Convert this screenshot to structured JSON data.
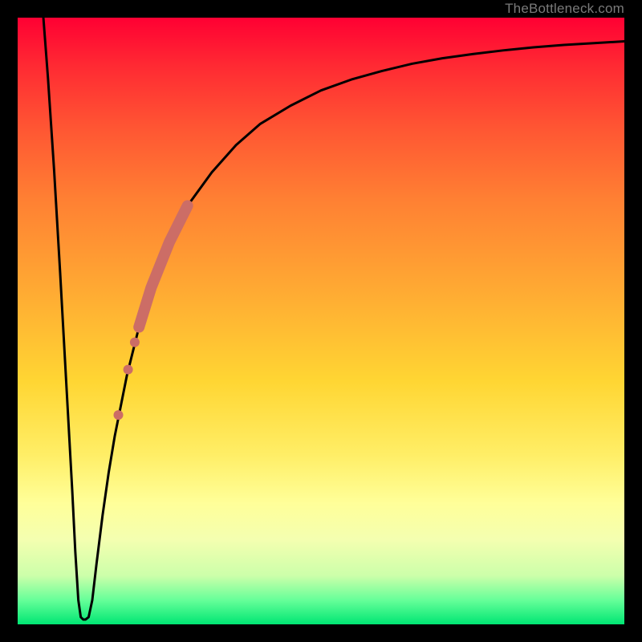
{
  "watermark": "TheBottleneck.com",
  "colors": {
    "frame": "#000000",
    "curve": "#000000",
    "highlight_stroke": "#cc6d66",
    "highlight_fill": "#cc6d66"
  },
  "chart_data": {
    "type": "line",
    "title": "",
    "xlabel": "",
    "ylabel": "",
    "xlim": [
      0,
      100
    ],
    "ylim": [
      0,
      100
    ],
    "grid": false,
    "legend": false,
    "curve_points": [
      {
        "x": 4.24,
        "y": 100.0
      },
      {
        "x": 5.0,
        "y": 90.0
      },
      {
        "x": 6.0,
        "y": 75.0
      },
      {
        "x": 7.0,
        "y": 58.0
      },
      {
        "x": 8.0,
        "y": 40.0
      },
      {
        "x": 9.0,
        "y": 22.0
      },
      {
        "x": 9.5,
        "y": 12.0
      },
      {
        "x": 10.0,
        "y": 4.0
      },
      {
        "x": 10.4,
        "y": 1.2
      },
      {
        "x": 10.8,
        "y": 0.8
      },
      {
        "x": 11.2,
        "y": 0.8
      },
      {
        "x": 11.7,
        "y": 1.2
      },
      {
        "x": 12.3,
        "y": 4.0
      },
      {
        "x": 13.0,
        "y": 10.0
      },
      {
        "x": 14.0,
        "y": 18.0
      },
      {
        "x": 15.0,
        "y": 25.0
      },
      {
        "x": 16.0,
        "y": 31.0
      },
      {
        "x": 18.0,
        "y": 41.0
      },
      {
        "x": 20.0,
        "y": 49.0
      },
      {
        "x": 22.0,
        "y": 55.5
      },
      {
        "x": 25.0,
        "y": 63.0
      },
      {
        "x": 28.0,
        "y": 69.0
      },
      {
        "x": 32.0,
        "y": 74.5
      },
      {
        "x": 36.0,
        "y": 79.0
      },
      {
        "x": 40.0,
        "y": 82.5
      },
      {
        "x": 45.0,
        "y": 85.5
      },
      {
        "x": 50.0,
        "y": 88.0
      },
      {
        "x": 55.0,
        "y": 89.8
      },
      {
        "x": 60.0,
        "y": 91.2
      },
      {
        "x": 65.0,
        "y": 92.4
      },
      {
        "x": 70.0,
        "y": 93.3
      },
      {
        "x": 75.0,
        "y": 94.0
      },
      {
        "x": 80.0,
        "y": 94.6
      },
      {
        "x": 85.0,
        "y": 95.1
      },
      {
        "x": 90.0,
        "y": 95.5
      },
      {
        "x": 95.0,
        "y": 95.8
      },
      {
        "x": 100.0,
        "y": 96.1
      }
    ],
    "highlight_segment": {
      "comment": "thick pinkish segment along the rising part of the curve",
      "points": [
        {
          "x": 20.0,
          "y": 49.0
        },
        {
          "x": 22.0,
          "y": 55.5
        },
        {
          "x": 25.0,
          "y": 63.0
        },
        {
          "x": 28.0,
          "y": 69.0
        }
      ],
      "stroke_width": 14
    },
    "highlight_dots": [
      {
        "x": 19.3,
        "y": 46.5,
        "r": 6
      },
      {
        "x": 18.2,
        "y": 42.0,
        "r": 6
      },
      {
        "x": 16.6,
        "y": 34.5,
        "r": 6
      }
    ]
  }
}
